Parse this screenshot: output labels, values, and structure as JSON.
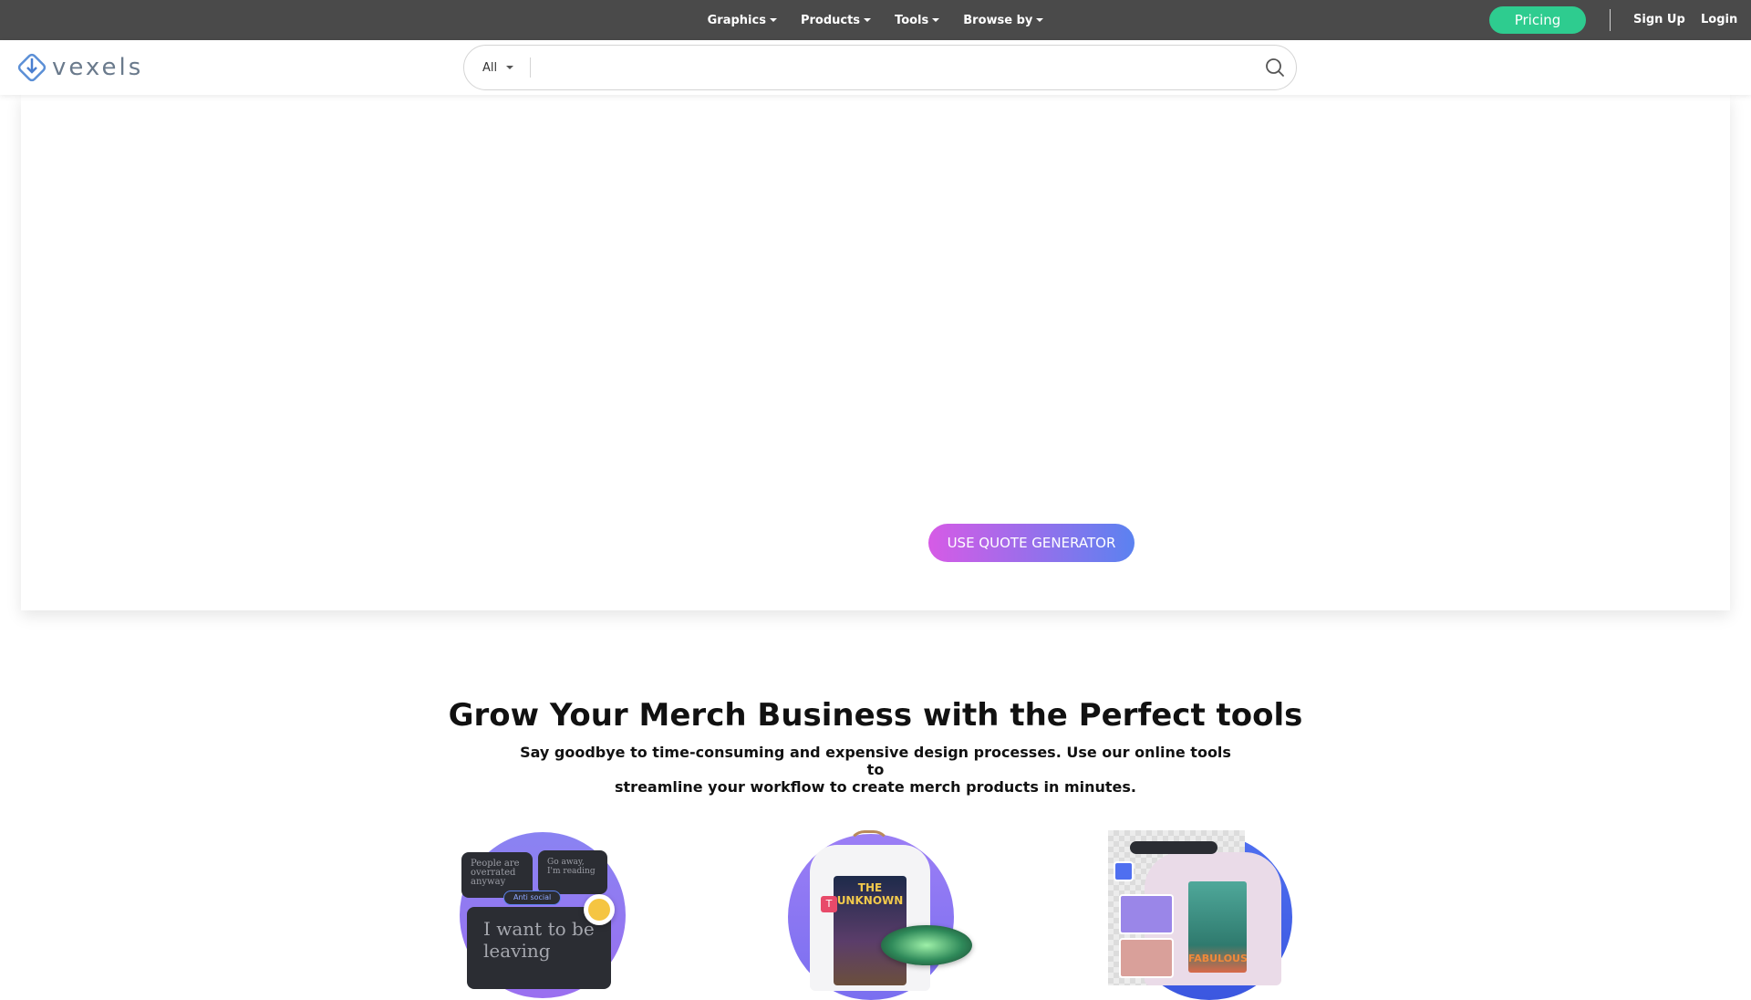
{
  "topnav": {
    "items": [
      {
        "label": "Graphics"
      },
      {
        "label": "Products"
      },
      {
        "label": "Tools"
      },
      {
        "label": "Browse by"
      }
    ],
    "pricing_label": "Pricing",
    "signup_label": "Sign Up",
    "login_label": "Login"
  },
  "header": {
    "logo_text": "vexels",
    "search": {
      "category": "All",
      "placeholder": "",
      "value": ""
    }
  },
  "hero": {
    "cta_label": "USE QUOTE GENERATOR"
  },
  "section": {
    "title": "Grow Your Merch Business with the Perfect tools",
    "subtitle_line1": "Say goodbye to time-consuming and expensive design processes. Use our online tools to",
    "subtitle_line2": "streamline your workflow to create merch products in minutes."
  },
  "tools": {
    "quote_card": {
      "text_top_left": "People are overrated anyway",
      "text_top_right": "Go away, I'm reading",
      "chip": "Anti social",
      "main_text": "I want to be leaving"
    },
    "tshirt_text": "THE UNKNOWN",
    "sweater_text": "FABULOUS"
  },
  "colors": {
    "topbar": "#4a4a4a",
    "pricing": "#2ecc8f",
    "cta_start": "#d65be6",
    "cta_end": "#5b82f0"
  }
}
